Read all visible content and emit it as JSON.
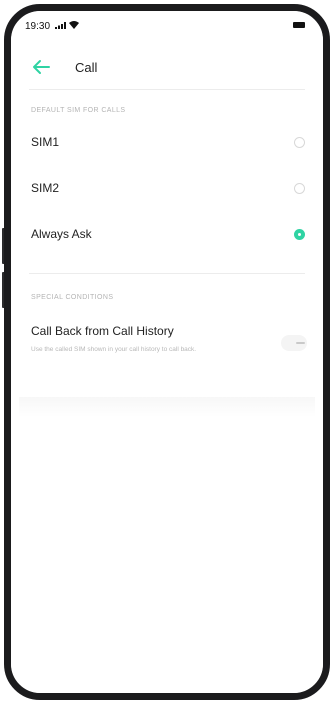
{
  "status_bar": {
    "time": "19:30",
    "icons": [
      "signal-icon",
      "wifi-icon",
      "battery-icon"
    ]
  },
  "app_bar": {
    "back_icon": "back-arrow-icon",
    "title": "Call"
  },
  "sections": {
    "default_sim_header": "DEFAULT SIM FOR CALLS",
    "options": [
      {
        "label": "SIM1",
        "selected": false
      },
      {
        "label": "SIM2",
        "selected": false
      },
      {
        "label": "Always Ask",
        "selected": true
      }
    ],
    "special_conditions_header": "SPECIAL CONDITIONS",
    "call_back": {
      "title": "Call Back from Call History",
      "description": "Use the called SIM shown in your call history to call back.",
      "enabled": false
    }
  },
  "colors": {
    "accent": "#2fd3a3",
    "text_primary": "#222222",
    "text_secondary": "#b4b4b4"
  }
}
